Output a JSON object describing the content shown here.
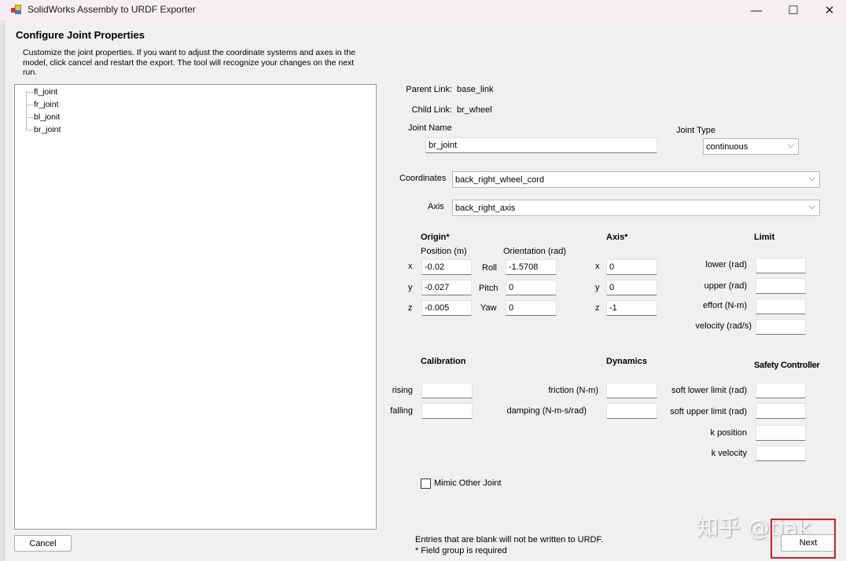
{
  "window": {
    "title": "SolidWorks Assembly to URDF Exporter",
    "minimize": "—",
    "maximize": "☐",
    "close": "✕"
  },
  "heading": "Configure Joint Properties",
  "description": "Customize the joint properties. If you want to adjust the coordinate systems and axes in the model, click cancel and restart the export. The tool will recognize your changes on the next run.",
  "tree": [
    "fl_joint",
    "fr_joint",
    "bl_jonit",
    "br_joint"
  ],
  "parent_link": {
    "label": "Parent Link:",
    "value": "base_link"
  },
  "child_link": {
    "label": "Child Link:",
    "value": "br_wheel"
  },
  "joint_name": {
    "label": "Joint Name",
    "value": "br_joint"
  },
  "joint_type": {
    "label": "Joint Type",
    "value": "continuous"
  },
  "coordinates": {
    "label": "Coordinates",
    "value": "back_right_wheel_cord"
  },
  "axis_select": {
    "label": "Axis",
    "value": "back_right_axis"
  },
  "origin": {
    "title": "Origin*",
    "position_label": "Position (m)",
    "orientation_label": "Orientation (rad)",
    "x_label": "x",
    "y_label": "y",
    "z_label": "z",
    "x": "-0.02",
    "y": "-0.027",
    "z": "-0.005",
    "roll_label": "Roll",
    "pitch_label": "Pitch",
    "yaw_label": "Yaw",
    "roll": "-1.5708",
    "pitch": "0",
    "yaw": "0"
  },
  "axis": {
    "title": "Axis*",
    "x_label": "x",
    "y_label": "y",
    "z_label": "z",
    "x": "0",
    "y": "0",
    "z": "-1"
  },
  "limit": {
    "title": "Limit",
    "lower": "lower (rad)",
    "upper": "upper (rad)",
    "effort": "effort (N-m)",
    "velocity": "velocity (rad/s)"
  },
  "calibration": {
    "title": "Calibration",
    "rising": "rising",
    "falling": "falling"
  },
  "dynamics": {
    "title": "Dynamics",
    "friction": "friction (N-m)",
    "damping": "damping (N-m-s/rad)"
  },
  "safety": {
    "title": "Safety Controller",
    "soft_lower": "soft lower limit (rad)",
    "soft_upper": "soft upper limit (rad)",
    "k_position": "k position",
    "k_velocity": "k velocity"
  },
  "mimic": {
    "label": "Mimic Other Joint",
    "checked": false
  },
  "footer": {
    "line1": "Entries that are blank will not be written to URDF.",
    "line2": "* Field group is required"
  },
  "buttons": {
    "cancel": "Cancel",
    "next": "Next"
  },
  "watermark": "知乎 @tiak",
  "colors": {
    "highlight": "#e02020"
  }
}
